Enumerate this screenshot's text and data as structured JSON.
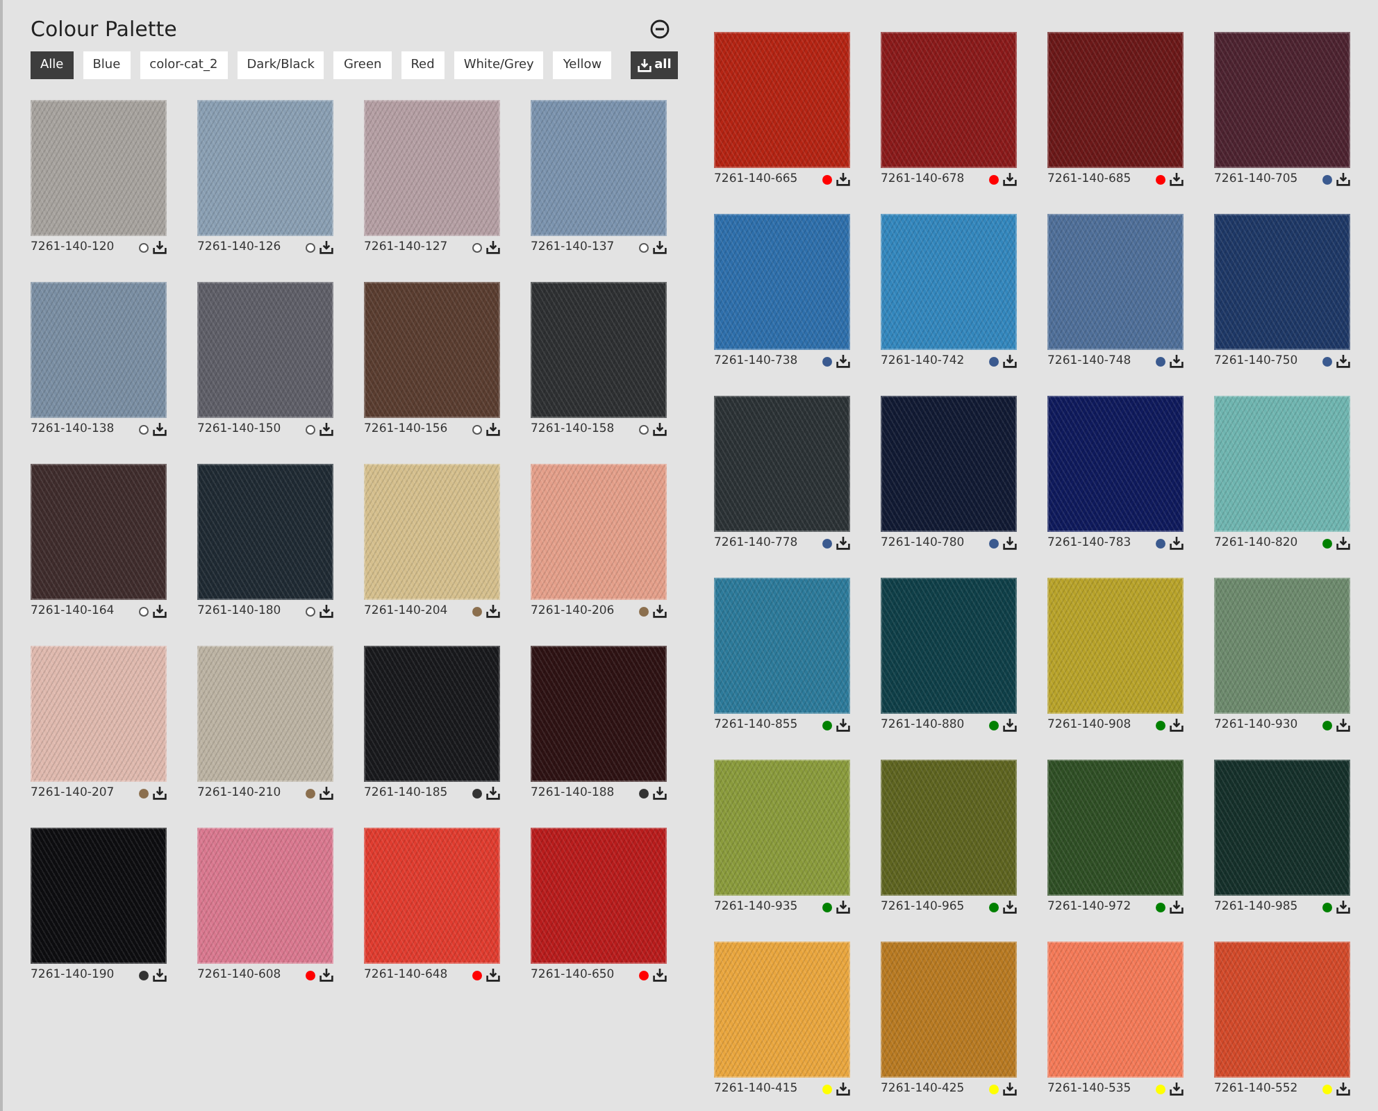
{
  "title": "Colour Palette",
  "filters": [
    {
      "label": "Alle",
      "selected": true
    },
    {
      "label": "Blue",
      "selected": false
    },
    {
      "label": "color-cat_2",
      "selected": false
    },
    {
      "label": "Dark/Black",
      "selected": false
    },
    {
      "label": "Green",
      "selected": false
    },
    {
      "label": "Red",
      "selected": false
    },
    {
      "label": "White/Grey",
      "selected": false
    },
    {
      "label": "Yellow",
      "selected": false
    }
  ],
  "download_all": {
    "label": "all"
  },
  "left_swatches": [
    {
      "code": "7261-140-120",
      "color": "#a7a39e",
      "category": {
        "color": "#ffffff"
      }
    },
    {
      "code": "7261-140-126",
      "color": "#8a9fb3",
      "category": {
        "color": "#ffffff"
      }
    },
    {
      "code": "7261-140-127",
      "color": "#b59fa4",
      "category": {
        "color": "#ffffff"
      }
    },
    {
      "code": "7261-140-137",
      "color": "#7b93ae",
      "category": {
        "color": "#ffffff"
      }
    },
    {
      "code": "7261-140-138",
      "color": "#7a8ea3",
      "category": {
        "color": "#ffffff"
      }
    },
    {
      "code": "7261-140-150",
      "color": "#5f5f68",
      "category": {
        "color": "#ffffff"
      }
    },
    {
      "code": "7261-140-156",
      "color": "#5a3d30",
      "category": {
        "color": "#ffffff"
      }
    },
    {
      "code": "7261-140-158",
      "color": "#2e3032",
      "category": {
        "color": "#ffffff"
      }
    },
    {
      "code": "7261-140-164",
      "color": "#3f2c2c",
      "category": {
        "color": "#ffffff"
      }
    },
    {
      "code": "7261-140-180",
      "color": "#1f2a33",
      "category": {
        "color": "#ffffff"
      }
    },
    {
      "code": "7261-140-204",
      "color": "#d5bf8d",
      "category": {
        "color": "#8b6f4e"
      }
    },
    {
      "code": "7261-140-206",
      "color": "#e49f8a",
      "category": {
        "color": "#8b6f4e"
      }
    },
    {
      "code": "7261-140-207",
      "color": "#dfb9ae",
      "category": {
        "color": "#8b6f4e"
      }
    },
    {
      "code": "7261-140-210",
      "color": "#bcb3a3",
      "category": {
        "color": "#8b6f4e"
      }
    },
    {
      "code": "7261-140-185",
      "color": "#18191c",
      "category": {
        "color": "#333333"
      }
    },
    {
      "code": "7261-140-188",
      "color": "#2e1213",
      "category": {
        "color": "#333333"
      }
    },
    {
      "code": "7261-140-190",
      "color": "#0d0d10",
      "category": {
        "color": "#333333"
      }
    },
    {
      "code": "7261-140-608",
      "color": "#d9788f",
      "category": {
        "color": "#ff0000"
      }
    },
    {
      "code": "7261-140-648",
      "color": "#e03c2f",
      "category": {
        "color": "#ff0000"
      }
    },
    {
      "code": "7261-140-650",
      "color": "#b81c1c",
      "category": {
        "color": "#ff0000"
      }
    }
  ],
  "right_swatches": [
    {
      "code": "7261-140-665",
      "color": "#b42413",
      "category": {
        "color": "#ff0000"
      }
    },
    {
      "code": "7261-140-678",
      "color": "#8a1a1a",
      "category": {
        "color": "#ff0000"
      }
    },
    {
      "code": "7261-140-685",
      "color": "#6b1818",
      "category": {
        "color": "#ff0000"
      }
    },
    {
      "code": "7261-140-705",
      "color": "#4d2330",
      "category": {
        "color": "#3b5a8f"
      }
    },
    {
      "code": "7261-140-738",
      "color": "#2e6fab",
      "category": {
        "color": "#3b5a8f"
      }
    },
    {
      "code": "7261-140-742",
      "color": "#3387bd",
      "category": {
        "color": "#3b5a8f"
      }
    },
    {
      "code": "7261-140-748",
      "color": "#4f6f99",
      "category": {
        "color": "#3b5a8f"
      }
    },
    {
      "code": "7261-140-750",
      "color": "#1e3866",
      "category": {
        "color": "#3b5a8f"
      }
    },
    {
      "code": "7261-140-778",
      "color": "#2b3235",
      "category": {
        "color": "#3b5a8f"
      }
    },
    {
      "code": "7261-140-780",
      "color": "#111a33",
      "category": {
        "color": "#3b5a8f"
      }
    },
    {
      "code": "7261-140-783",
      "color": "#0f1a5c",
      "category": {
        "color": "#3b5a8f"
      }
    },
    {
      "code": "7261-140-820",
      "color": "#6fb5b0",
      "category": {
        "color": "#008000"
      }
    },
    {
      "code": "7261-140-855",
      "color": "#2c7a9a",
      "category": {
        "color": "#008000"
      }
    },
    {
      "code": "7261-140-880",
      "color": "#0f3f48",
      "category": {
        "color": "#008000"
      }
    },
    {
      "code": "7261-140-908",
      "color": "#b8a32a",
      "category": {
        "color": "#008000"
      }
    },
    {
      "code": "7261-140-930",
      "color": "#6d8a6d",
      "category": {
        "color": "#008000"
      }
    },
    {
      "code": "7261-140-935",
      "color": "#8a9b3c",
      "category": {
        "color": "#008000"
      }
    },
    {
      "code": "7261-140-965",
      "color": "#5e6420",
      "category": {
        "color": "#008000"
      }
    },
    {
      "code": "7261-140-972",
      "color": "#2f4f25",
      "category": {
        "color": "#008000"
      }
    },
    {
      "code": "7261-140-985",
      "color": "#15302a",
      "category": {
        "color": "#008000"
      }
    },
    {
      "code": "7261-140-415",
      "color": "#e9a63e",
      "category": {
        "color": "#ffff00"
      }
    },
    {
      "code": "7261-140-425",
      "color": "#b87a22",
      "category": {
        "color": "#ffff00"
      }
    },
    {
      "code": "7261-140-535",
      "color": "#f47a58",
      "category": {
        "color": "#ffff00"
      }
    },
    {
      "code": "7261-140-552",
      "color": "#d24a2a",
      "category": {
        "color": "#ffff00"
      }
    }
  ]
}
